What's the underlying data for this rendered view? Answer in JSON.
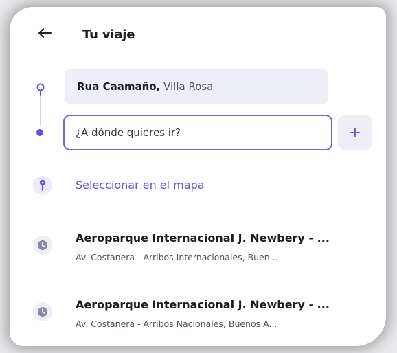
{
  "header": {
    "title": "Tu viaje",
    "back_icon": "back-arrow-icon"
  },
  "route": {
    "origin_street": "Rua Caamaño,",
    "origin_area": "Villa Rosa",
    "destination_placeholder": "¿A dónde quieres ir?",
    "destination_value": "",
    "add_stop_label": "+"
  },
  "select_map": {
    "label": "Seleccionar en el mapa",
    "icon": "map-pin-icon"
  },
  "history": [
    {
      "title": "Aeroparque Internacional J. Newbery - ...",
      "subtitle": "Av. Costanera - Arribos Internacionales, Buen...",
      "icon": "clock-icon"
    },
    {
      "title": "Aeroparque Internacional J. Newbery - ...",
      "subtitle": "Av. Costanera - Arribos Nacionales, Buenos A...",
      "icon": "clock-icon"
    }
  ],
  "colors": {
    "accent": "#6a4ee0",
    "field_bg": "#eeeff6",
    "text_primary": "#1d1d24"
  }
}
